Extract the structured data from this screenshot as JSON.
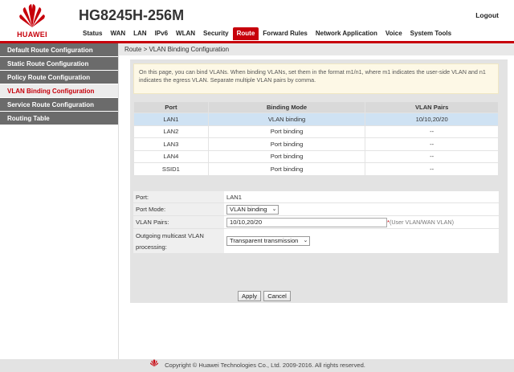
{
  "header": {
    "logo_text": "HUAWEI",
    "model": "HG8245H-256M",
    "logout": "Logout",
    "nav": [
      "Status",
      "WAN",
      "LAN",
      "IPv6",
      "WLAN",
      "Security",
      "Route",
      "Forward Rules",
      "Network Application",
      "Voice",
      "System Tools"
    ],
    "active_nav": "Route"
  },
  "sidebar": {
    "items": [
      {
        "label": "Default Route Configuration"
      },
      {
        "label": "Static Route Configuration"
      },
      {
        "label": "Policy Route Configuration"
      },
      {
        "label": "VLAN Binding Configuration"
      },
      {
        "label": "Service Route Configuration"
      },
      {
        "label": "Routing Table"
      }
    ],
    "active_index": 3
  },
  "breadcrumb": "Route > VLAN Binding Configuration",
  "note": "On this page, you can bind VLANs. When binding VLANs, set them in the format m1/n1, where m1 indicates the user-side VLAN and n1 indicates the egress VLAN. Separate multiple VLAN pairs by comma.",
  "table": {
    "headers": [
      "Port",
      "Binding Mode",
      "VLAN Pairs"
    ],
    "rows": [
      {
        "port": "LAN1",
        "mode": "VLAN binding",
        "pairs": "10/10,20/20"
      },
      {
        "port": "LAN2",
        "mode": "Port binding",
        "pairs": "--"
      },
      {
        "port": "LAN3",
        "mode": "Port binding",
        "pairs": "--"
      },
      {
        "port": "LAN4",
        "mode": "Port binding",
        "pairs": "--"
      },
      {
        "port": "SSID1",
        "mode": "Port binding",
        "pairs": "--"
      }
    ],
    "selected_row": 0
  },
  "form": {
    "port_label": "Port:",
    "port_value": "LAN1",
    "mode_label": "Port Mode:",
    "mode_value": "VLAN binding",
    "pairs_label": "VLAN Pairs:",
    "pairs_value": "10/10,20/20",
    "pairs_required": "*",
    "pairs_hint": "(User VLAN/WAN VLAN)",
    "multicast_label_1": "Outgoing multicast VLAN",
    "multicast_label_2": "processing:",
    "multicast_value": "Transparent transmission"
  },
  "buttons": {
    "apply": "Apply",
    "cancel": "Cancel"
  },
  "footer": "Copyright © Huawei Technologies Co., Ltd. 2009-2016. All rights reserved.",
  "colors": {
    "brand": "#c7000b",
    "sidebar": "#6b6b6b",
    "selected_row": "#cfe2f3"
  }
}
